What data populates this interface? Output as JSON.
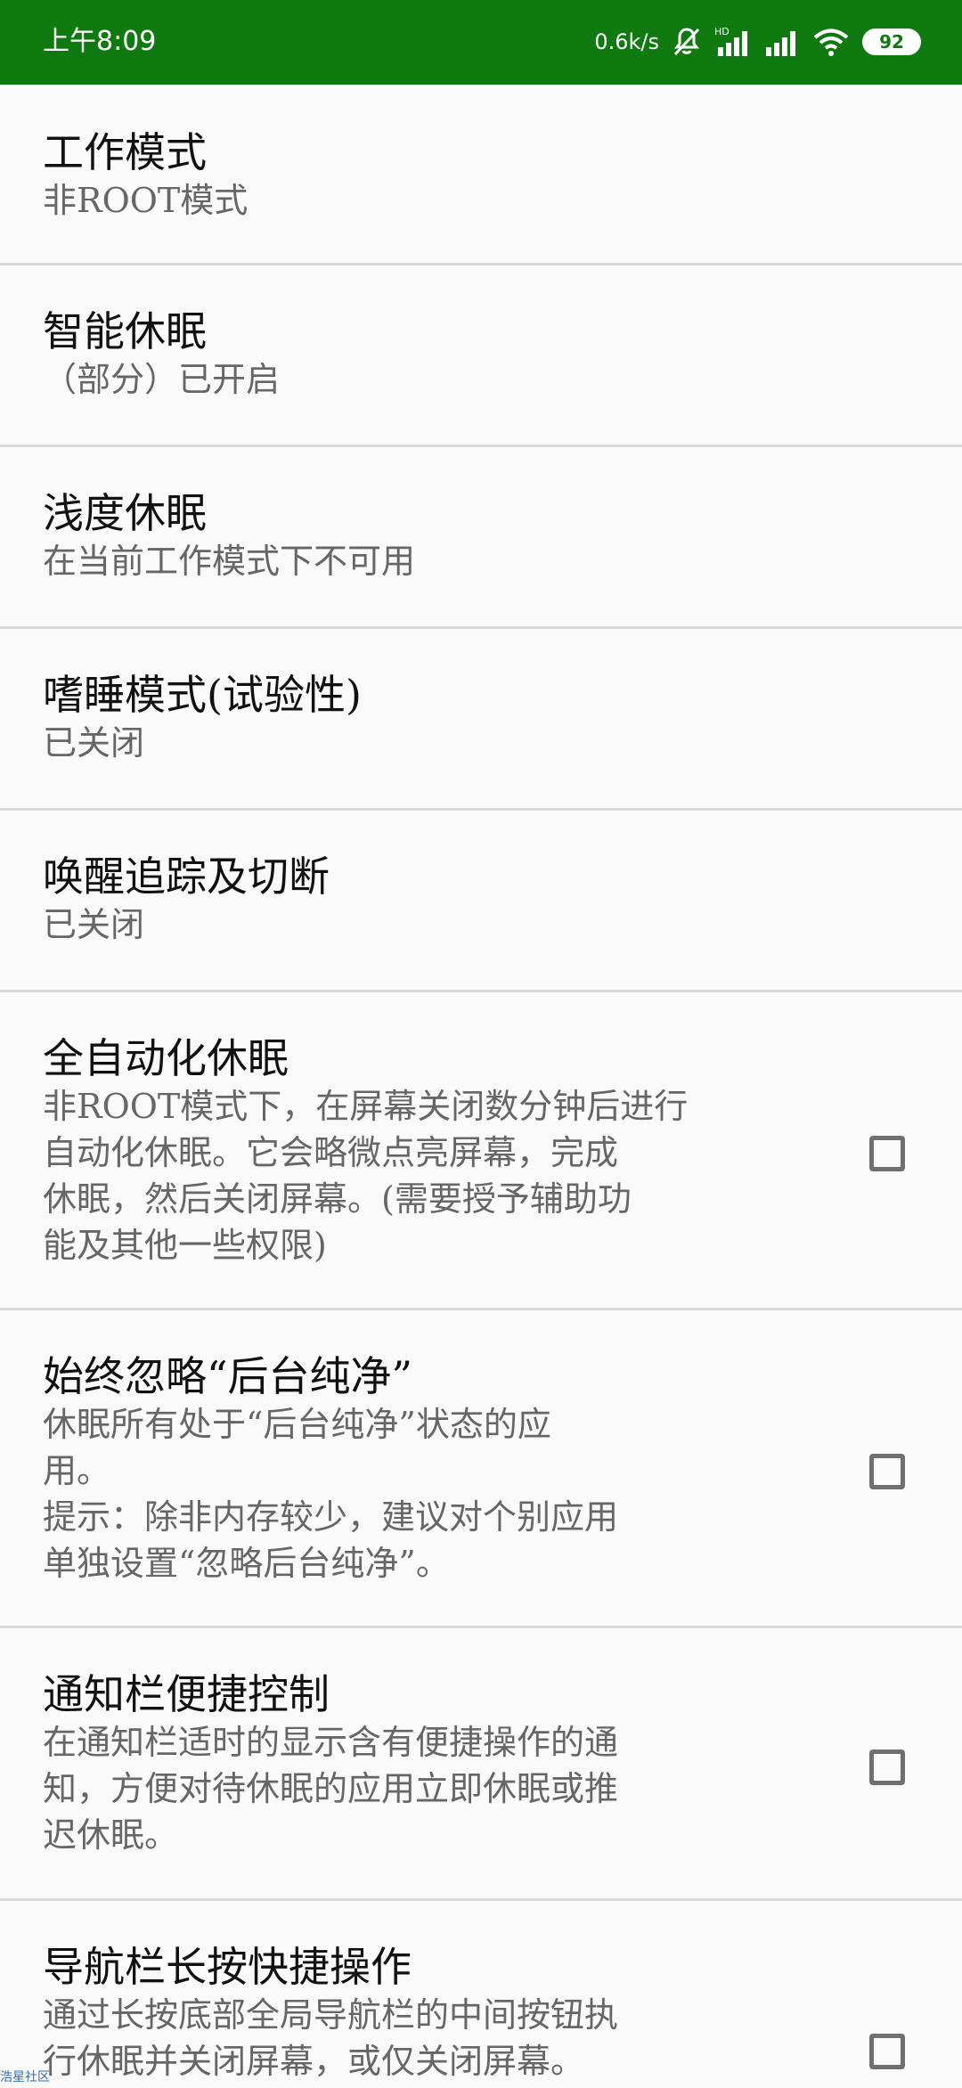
{
  "status_bar": {
    "time": "上午8:09",
    "network_speed": "0.6k/s",
    "battery": "92",
    "icons": [
      "bell-off-icon",
      "hd-signal-icon",
      "signal-icon",
      "wifi-icon",
      "battery-icon"
    ]
  },
  "settings": [
    {
      "title": "工作模式",
      "summary": "非ROOT模式",
      "has_checkbox": false
    },
    {
      "title": "智能休眠",
      "summary": "（部分）已开启",
      "has_checkbox": false
    },
    {
      "title": "浅度休眠",
      "summary": "在当前工作模式下不可用",
      "has_checkbox": false
    },
    {
      "title": "嗜睡模式(试验性)",
      "summary": "已关闭",
      "has_checkbox": false
    },
    {
      "title": "唤醒追踪及切断",
      "summary": "已关闭",
      "has_checkbox": false
    },
    {
      "title": "全自动化休眠",
      "summary": "非ROOT模式下，在屏幕关闭数分钟后进行\n自动化休眠。它会略微点亮屏幕，完成\n休眠，然后关闭屏幕。(需要授予辅助功\n能及其他一些权限)",
      "has_checkbox": true,
      "checked": false
    },
    {
      "title": "始终忽略“后台纯净”",
      "summary": "休眠所有处于“后台纯净”状态的应\n用。\n提示：除非内存较少，建议对个别应用\n单独设置“忽略后台纯净”。",
      "has_checkbox": true,
      "checked": false
    },
    {
      "title": "通知栏便捷控制",
      "summary": "在通知栏适时的显示含有便捷操作的通\n知，方便对待休眠的应用立即休眠或推\n迟休眠。",
      "has_checkbox": true,
      "checked": false
    },
    {
      "title": "导航栏长按快捷操作",
      "summary": "通过长按底部全局导航栏的中间按钮执\n行休眠并关闭屏幕，或仅关闭屏幕。",
      "has_checkbox": true,
      "checked": false
    }
  ],
  "watermark": "浩星社区"
}
